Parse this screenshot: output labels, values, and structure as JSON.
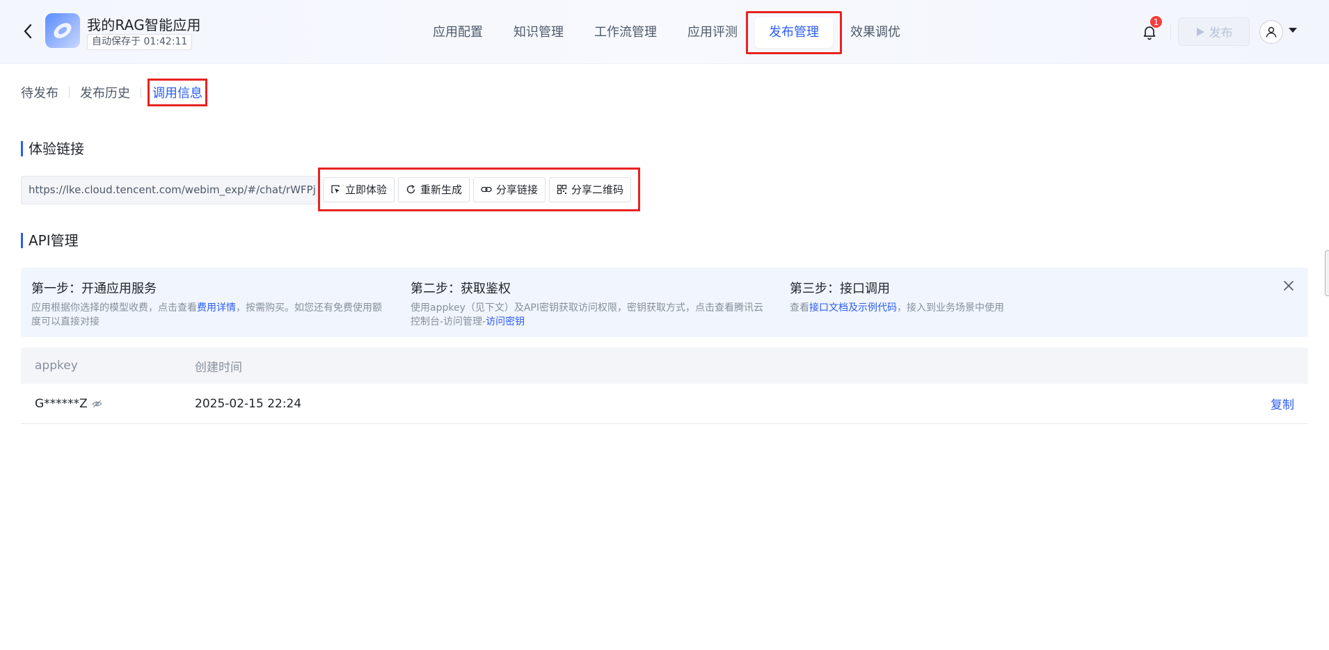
{
  "header": {
    "app_name": "我的RAG智能应用",
    "autosave": "自动保存于 01:42:11",
    "nav": [
      "应用配置",
      "知识管理",
      "工作流管理",
      "应用评测",
      "发布管理",
      "效果调优"
    ],
    "notification_count": "1",
    "publish_label": "发布"
  },
  "subtabs": [
    "待发布",
    "发布历史",
    "调用信息"
  ],
  "experience": {
    "title": "体验链接",
    "url": "https://lke.cloud.tencent.com/webim_exp/#/chat/rWFPjk",
    "actions": [
      "立即体验",
      "重新生成",
      "分享链接",
      "分享二维码"
    ]
  },
  "api": {
    "title": "API管理",
    "steps": [
      {
        "title": "第一步：开通应用服务",
        "desc_pre": "应用根据你选择的模型收费，点击查看",
        "link": "费用详情",
        "desc_post": "，按需购买。如您还有免费使用额度可以直接对接"
      },
      {
        "title": "第二步：获取鉴权",
        "desc_pre": "使用appkey（见下文）及API密钥获取访问权限，密钥获取方式，点击查看腾讯云控制台-访问管理-",
        "link": "访问密钥",
        "desc_post": ""
      },
      {
        "title": "第三步：接口调用",
        "desc_pre": "查看",
        "link": "接口文档及示例代码",
        "desc_post": "，接入到业务场景中使用"
      }
    ],
    "table": {
      "headers": [
        "appkey",
        "创建时间"
      ],
      "rows": [
        {
          "appkey": "G******Z",
          "created": "2025-02-15 22:24",
          "action": "复制"
        }
      ]
    }
  },
  "colors": {
    "accent": "#2a5df5",
    "highlight": "#e8221f",
    "badge": "#f53f3f"
  },
  "icons": [
    "back-arrow-icon",
    "app-logo-icon",
    "bell-icon",
    "play-icon",
    "user-icon",
    "cursor-click-icon",
    "refresh-icon",
    "link-icon",
    "qrcode-icon",
    "close-icon",
    "eye-slash-icon"
  ]
}
